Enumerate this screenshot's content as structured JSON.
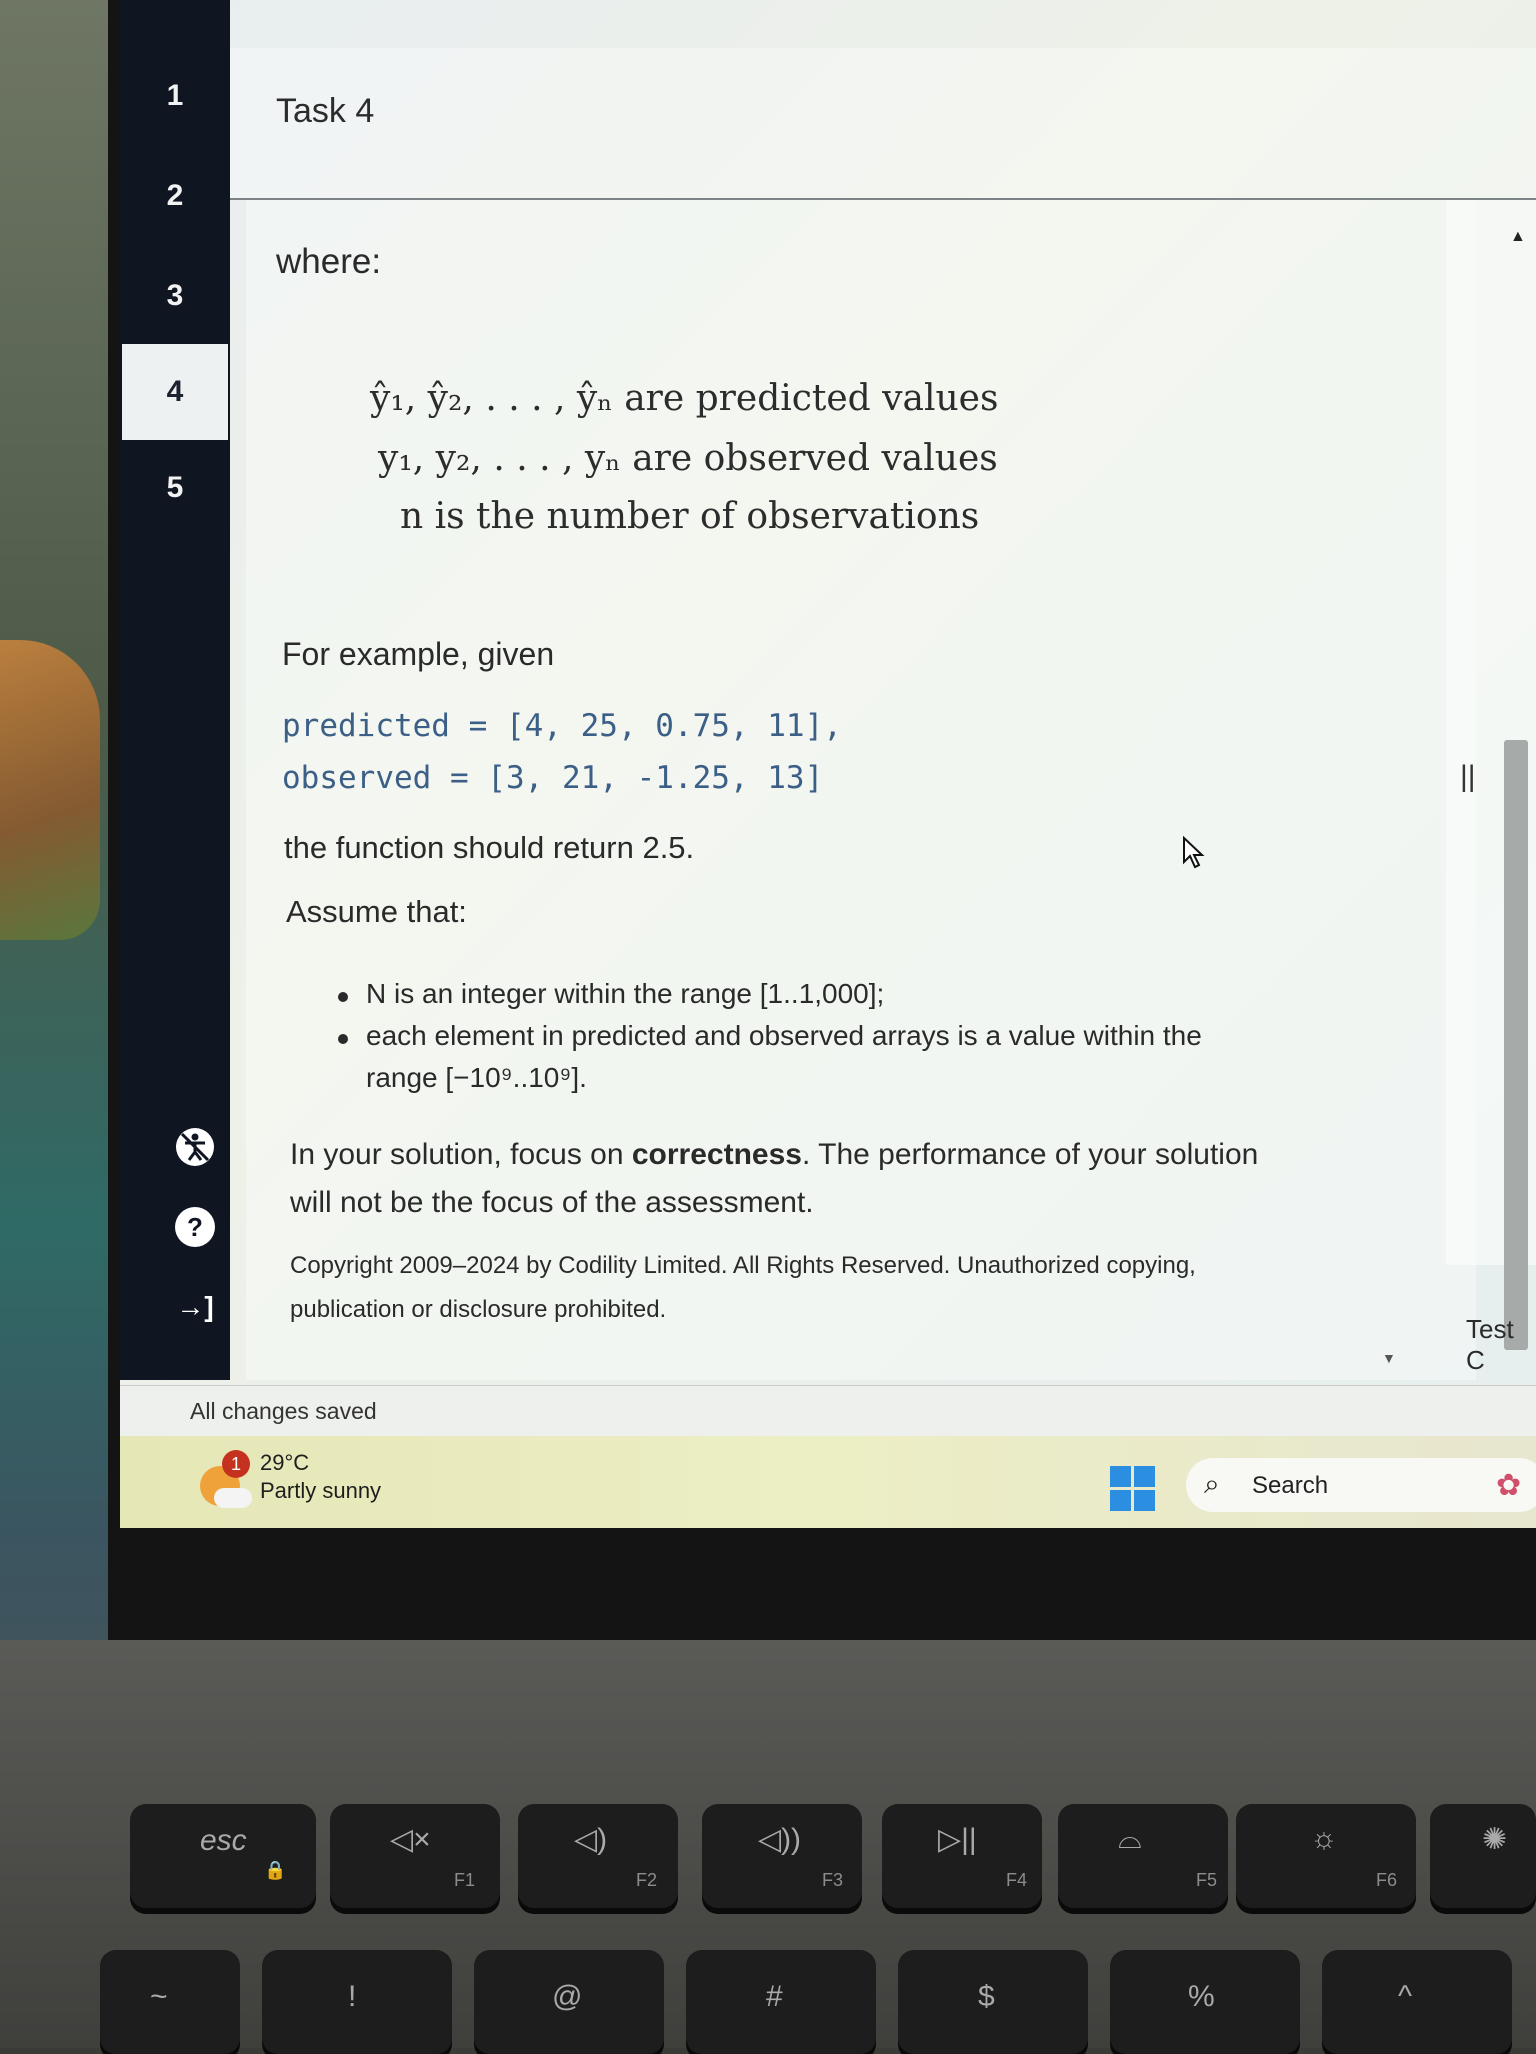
{
  "tasks": {
    "items": [
      "1",
      "2",
      "3",
      "4",
      "5"
    ],
    "active": "4",
    "icons": [
      "accessibility-icon",
      "help-icon",
      "logout-icon"
    ],
    "help_glyph": "?",
    "logout_glyph": "→]"
  },
  "header": {
    "title": "Task 4"
  },
  "content": {
    "where": "where:",
    "formula_lines": [
      "ŷ₁, ŷ₂, . . . , ŷₙ are predicted values",
      "y₁, y₂, . . . , yₙ are observed values",
      "n is the number of observations"
    ],
    "example_intro": "For example, given",
    "code_lines": [
      "predicted = [4, 25,  0.75, 11],",
      "observed  = [3, 21, -1.25, 13]"
    ],
    "return_text": "the function should return 2.5.",
    "assume": "Assume that:",
    "bullets": [
      "N is an integer within the range [1..1,000];",
      "each element in predicted and observed arrays is a value within the",
      "range [−10⁹..10⁹]."
    ],
    "focus_pre": "In your solution, focus on ",
    "focus_bold": "correctness",
    "focus_post": ". The performance of your solution",
    "focus_line2": "will not be the focus of the assessment.",
    "copyright_1": "Copyright 2009–2024 by Codility Limited. All Rights Reserved. Unauthorized copying,",
    "copyright_2": "publication or disclosure prohibited."
  },
  "right_panel": {
    "tab_label": "Test C",
    "split_handle": "||"
  },
  "status": {
    "saved": "All changes saved"
  },
  "taskbar": {
    "weather_badge": "1",
    "temperature": "29°C",
    "condition": "Partly sunny",
    "search_label": "Search"
  },
  "keyboard": {
    "fn_row": [
      {
        "main": "esc",
        "sub": ""
      },
      {
        "main": "◁×",
        "sub": "F1"
      },
      {
        "main": "◁)",
        "sub": "F2"
      },
      {
        "main": "◁))",
        "sub": "F3"
      },
      {
        "main": "▷||",
        "sub": "F4"
      },
      {
        "main": "⌓",
        "sub": "F5"
      },
      {
        "main": "☼",
        "sub": "F6"
      },
      {
        "main": "✺",
        "sub": ""
      }
    ],
    "num_row": [
      "~",
      "!",
      "@",
      "#",
      "$",
      "%",
      "^"
    ]
  },
  "colors": {
    "nav_bg": "#0f1521",
    "code": "#3b5f86",
    "scrollbar": "#a6aaa8",
    "windows_blue": "#2b8ee0"
  }
}
